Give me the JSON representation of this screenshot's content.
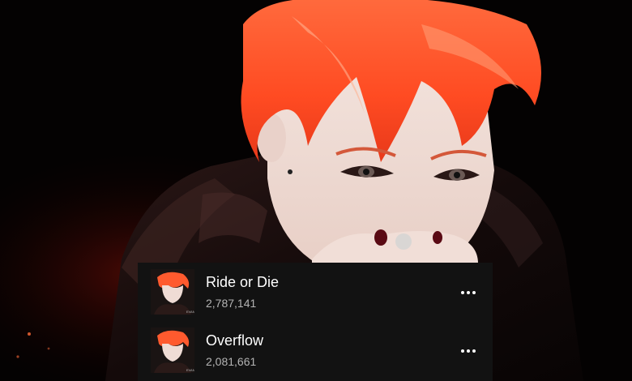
{
  "artist_photo": {
    "description_icon": "artist-portrait"
  },
  "tracks": [
    {
      "title": "Ride or Die",
      "plays": "2,787,141",
      "cover_icon": "album-cover-thumbnail",
      "menu_icon": "more-options-icon"
    },
    {
      "title": "Overflow",
      "plays": "2,081,661",
      "cover_icon": "album-cover-thumbnail",
      "menu_icon": "more-options-icon"
    }
  ],
  "colors": {
    "background": "#000000",
    "panel": "#121212",
    "title_text": "#ffffff",
    "plays_text": "#b3b3b3",
    "hair": "#ff5a2e"
  }
}
